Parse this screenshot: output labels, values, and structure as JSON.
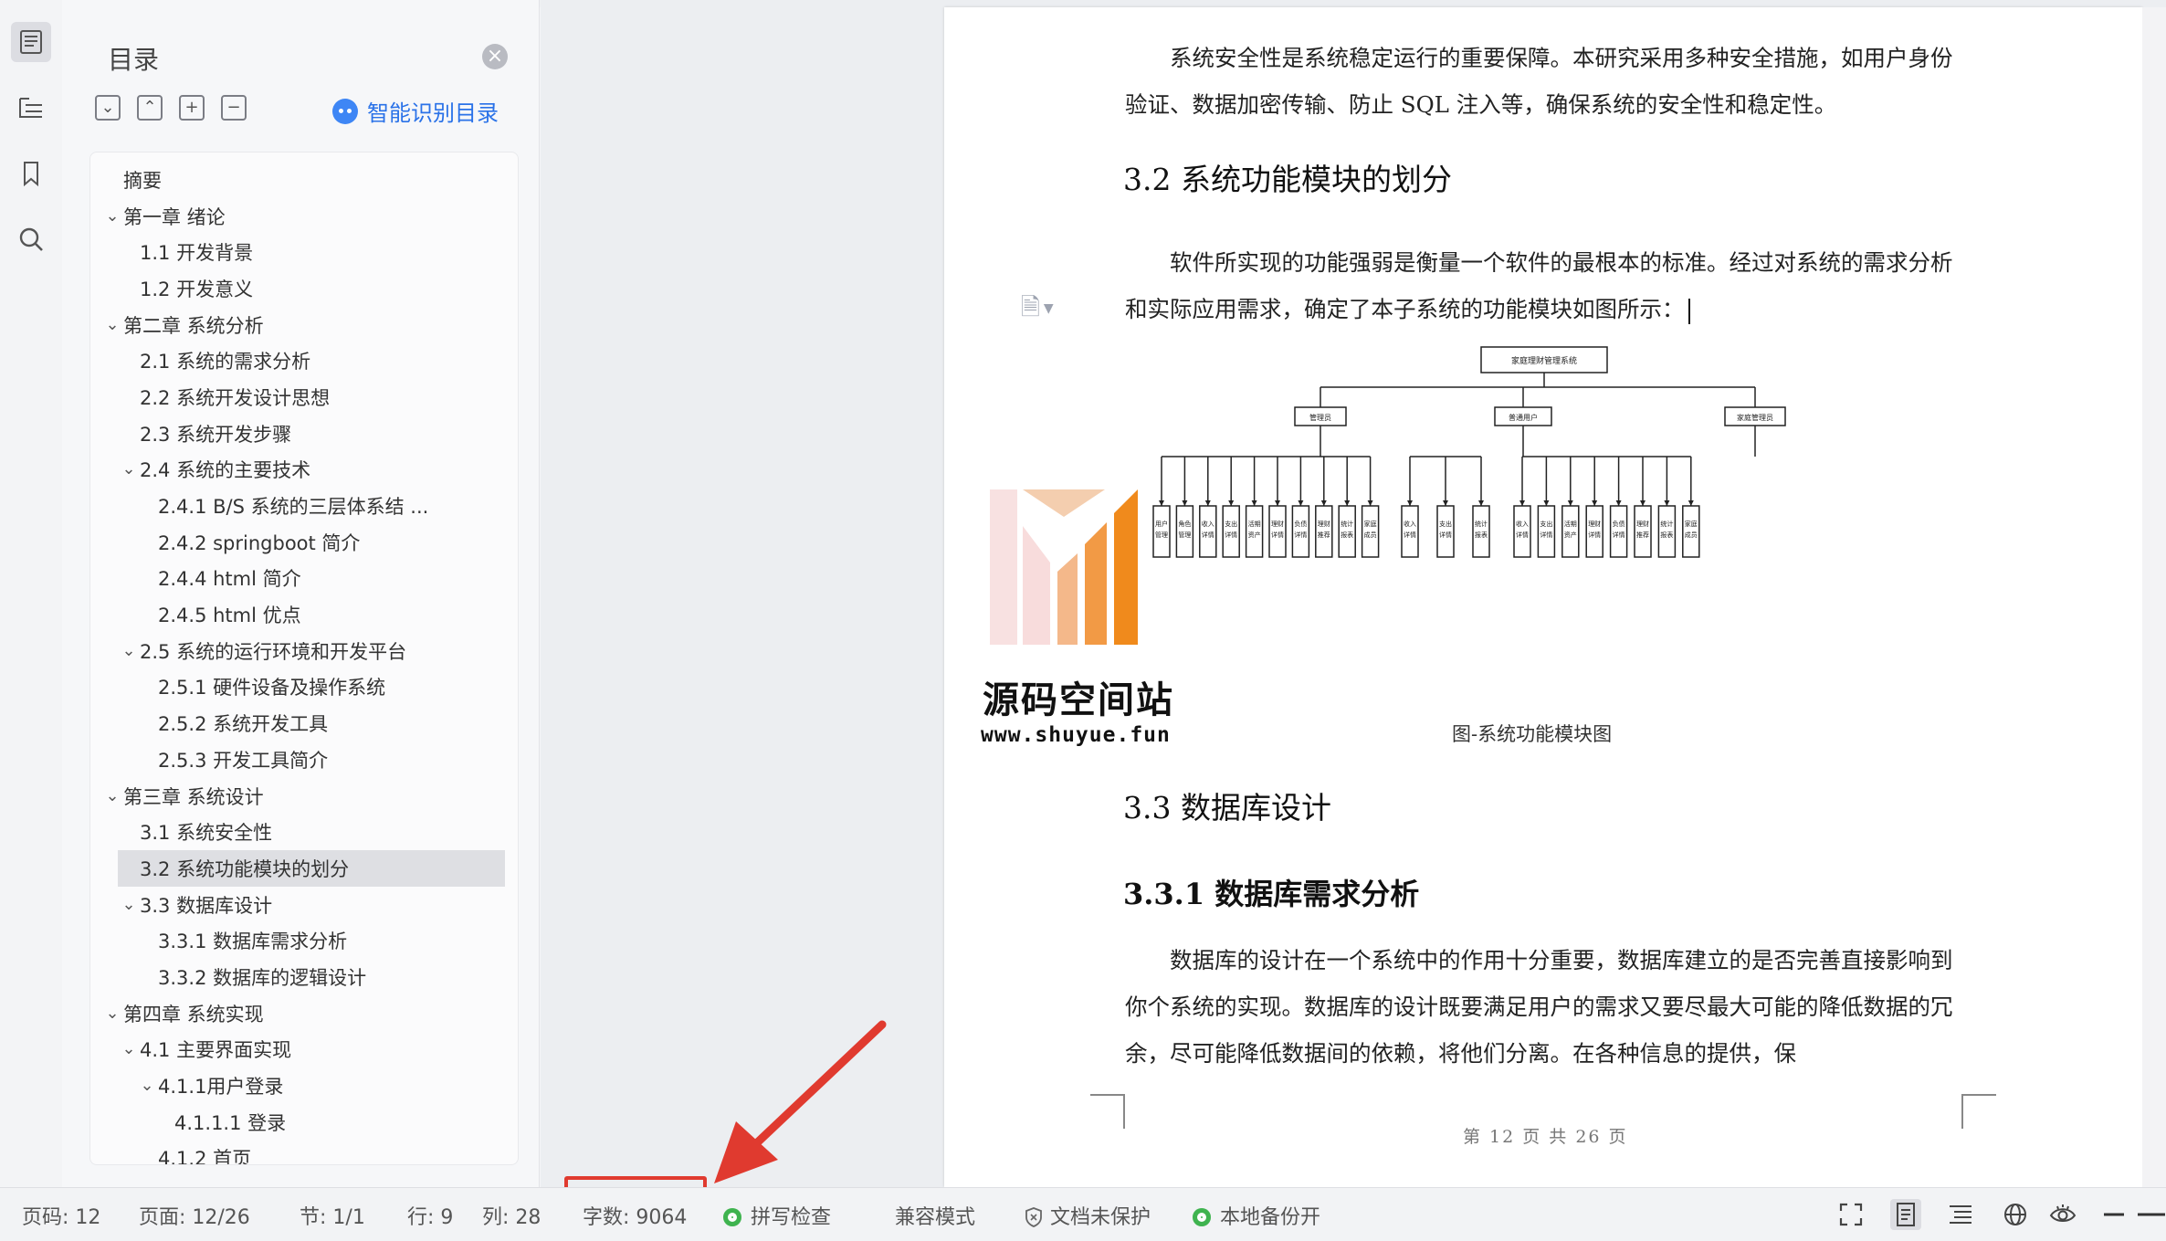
{
  "toc": {
    "title": "目录",
    "close_glyph": "×",
    "smart_label": "智能识别目录",
    "tools": [
      "collapse-all-icon",
      "expand-all-icon",
      "add-icon",
      "remove-icon"
    ],
    "items": [
      {
        "label": "摘要",
        "level": 0,
        "arrow": ""
      },
      {
        "label": "第一章  绪论",
        "level": 0,
        "arrow": "v"
      },
      {
        "label": "1.1  开发背景",
        "level": 1,
        "arrow": ""
      },
      {
        "label": "1.2  开发意义",
        "level": 1,
        "arrow": ""
      },
      {
        "label": "第二章  系统分析",
        "level": 0,
        "arrow": "v"
      },
      {
        "label": "2.1  系统的需求分析",
        "level": 1,
        "arrow": ""
      },
      {
        "label": "2.2   系统开发设计思想",
        "level": 1,
        "arrow": ""
      },
      {
        "label": "2.3  系统开发步骤",
        "level": 1,
        "arrow": ""
      },
      {
        "label": "2.4   系统的主要技术",
        "level": 1,
        "arrow": "v"
      },
      {
        "label": "2.4.1 B/S 系统的三层体系结 ...",
        "level": 2,
        "arrow": ""
      },
      {
        "label": "2.4.2 springboot 简介",
        "level": 2,
        "arrow": ""
      },
      {
        "label": "2.4.4 html 简介",
        "level": 2,
        "arrow": ""
      },
      {
        "label": "2.4.5 html 优点",
        "level": 2,
        "arrow": ""
      },
      {
        "label": "2.5   系统的运行环境和开发平台",
        "level": 1,
        "arrow": "v"
      },
      {
        "label": "2.5.1  硬件设备及操作系统",
        "level": 2,
        "arrow": ""
      },
      {
        "label": "2.5.2  系统开发工具",
        "level": 2,
        "arrow": ""
      },
      {
        "label": "2.5.3  开发工具简介",
        "level": 2,
        "arrow": ""
      },
      {
        "label": "第三章  系统设计",
        "level": 0,
        "arrow": "v"
      },
      {
        "label": "3.1 系统安全性",
        "level": 1,
        "arrow": ""
      },
      {
        "label": "3.2   系统功能模块的划分",
        "level": 1,
        "arrow": "",
        "selected": true
      },
      {
        "label": "3.3 数据库设计",
        "level": 1,
        "arrow": "v"
      },
      {
        "label": "3.3.1 数据库需求分析",
        "level": 2,
        "arrow": ""
      },
      {
        "label": "3.3.2 数据库的逻辑设计",
        "level": 2,
        "arrow": ""
      },
      {
        "label": "第四章  系统实现",
        "level": 0,
        "arrow": "v"
      },
      {
        "label": "4.1 主要界面实现",
        "level": 1,
        "arrow": "v"
      },
      {
        "label": "4.1.1用户登录",
        "level": 2,
        "arrow": "v"
      },
      {
        "label": "4.1.1.1  登录",
        "level": 3,
        "arrow": ""
      },
      {
        "label": "4.1.2  首页",
        "level": 2,
        "arrow": ""
      }
    ]
  },
  "document": {
    "para_security": "系统安全性是系统稳定运行的重要保障。本研究采用多种安全措施，如用户身份验证、数据加密传输、防止 SQL 注入等，确保系统的安全性和稳定性。",
    "heading_32": "3.2  系统功能模块的划分",
    "para_modules": "软件所实现的功能强弱是衡量一个软件的最根本的标准。经过对系统的需求分析和实际应用需求，确定了本子系统的功能模块如图所示：",
    "caption": "图-系统功能模块图",
    "heading_33": "3.3 数据库设计",
    "heading_331": "3.3.1 数据库需求分析",
    "para_db": "数据库的设计在一个系统中的作用十分重要，数据库建立的是否完善直接影响到你个系统的实现。数据库的设计既要满足用户的需求又要尽最大可能的降低数据的冗余，尽可能降低数据间的依赖，将他们分离。在各种信息的提供，保",
    "footer": "第 12 页 共 26 页"
  },
  "diagram": {
    "root": "家庭理财管理系统",
    "branches": [
      {
        "name": "管理员",
        "leaves": [
          "用户管理",
          "角色管理",
          "收入详情",
          "支出详情",
          "活期资产",
          "理财详情",
          "负债详情",
          "理财推荐",
          "统计报表",
          "家庭成员"
        ]
      },
      {
        "name": "普通用户",
        "leaves": [
          "收入详情",
          "支出详情",
          "统计报表"
        ]
      },
      {
        "name": "家庭管理员",
        "leaves": [
          "收入详情",
          "支出详情",
          "活期资产",
          "理财详情",
          "负债详情",
          "理财推荐",
          "统计报表",
          "家庭成员"
        ]
      }
    ]
  },
  "watermark": {
    "name": "源码空间站",
    "url": "www.shuyue.fun"
  },
  "status": {
    "page_code": "页码: 12",
    "page": "页面: 12/26",
    "section": "节: 1/1",
    "line": "行: 9",
    "col": "列: 28",
    "word_count": "字数: 9064",
    "spell_check": "拼写检查",
    "compat_mode": "兼容模式",
    "doc_protect": "文档未保护",
    "backup": "本地备份开"
  },
  "colors": {
    "accent": "#2a72e8",
    "annotation_red": "#e03a2f",
    "ok_green": "#3fb34f",
    "watermark_orange": "#f08a1c"
  }
}
